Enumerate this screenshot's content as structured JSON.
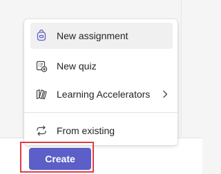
{
  "menu": {
    "items": [
      {
        "label": "New assignment",
        "icon": "assignment-icon",
        "active": true
      },
      {
        "label": "New quiz",
        "icon": "quiz-icon",
        "active": false
      },
      {
        "label": "Learning Accelerators",
        "icon": "learning-accelerators-icon",
        "active": false,
        "has_submenu": true
      },
      {
        "label": "From existing",
        "icon": "from-existing-icon",
        "active": false
      }
    ]
  },
  "footer": {
    "create_label": "Create"
  },
  "colors": {
    "accent": "#5b5fc7",
    "highlight": "#e03b45",
    "text": "#242424",
    "active_item_bg": "#f0f0f0"
  }
}
